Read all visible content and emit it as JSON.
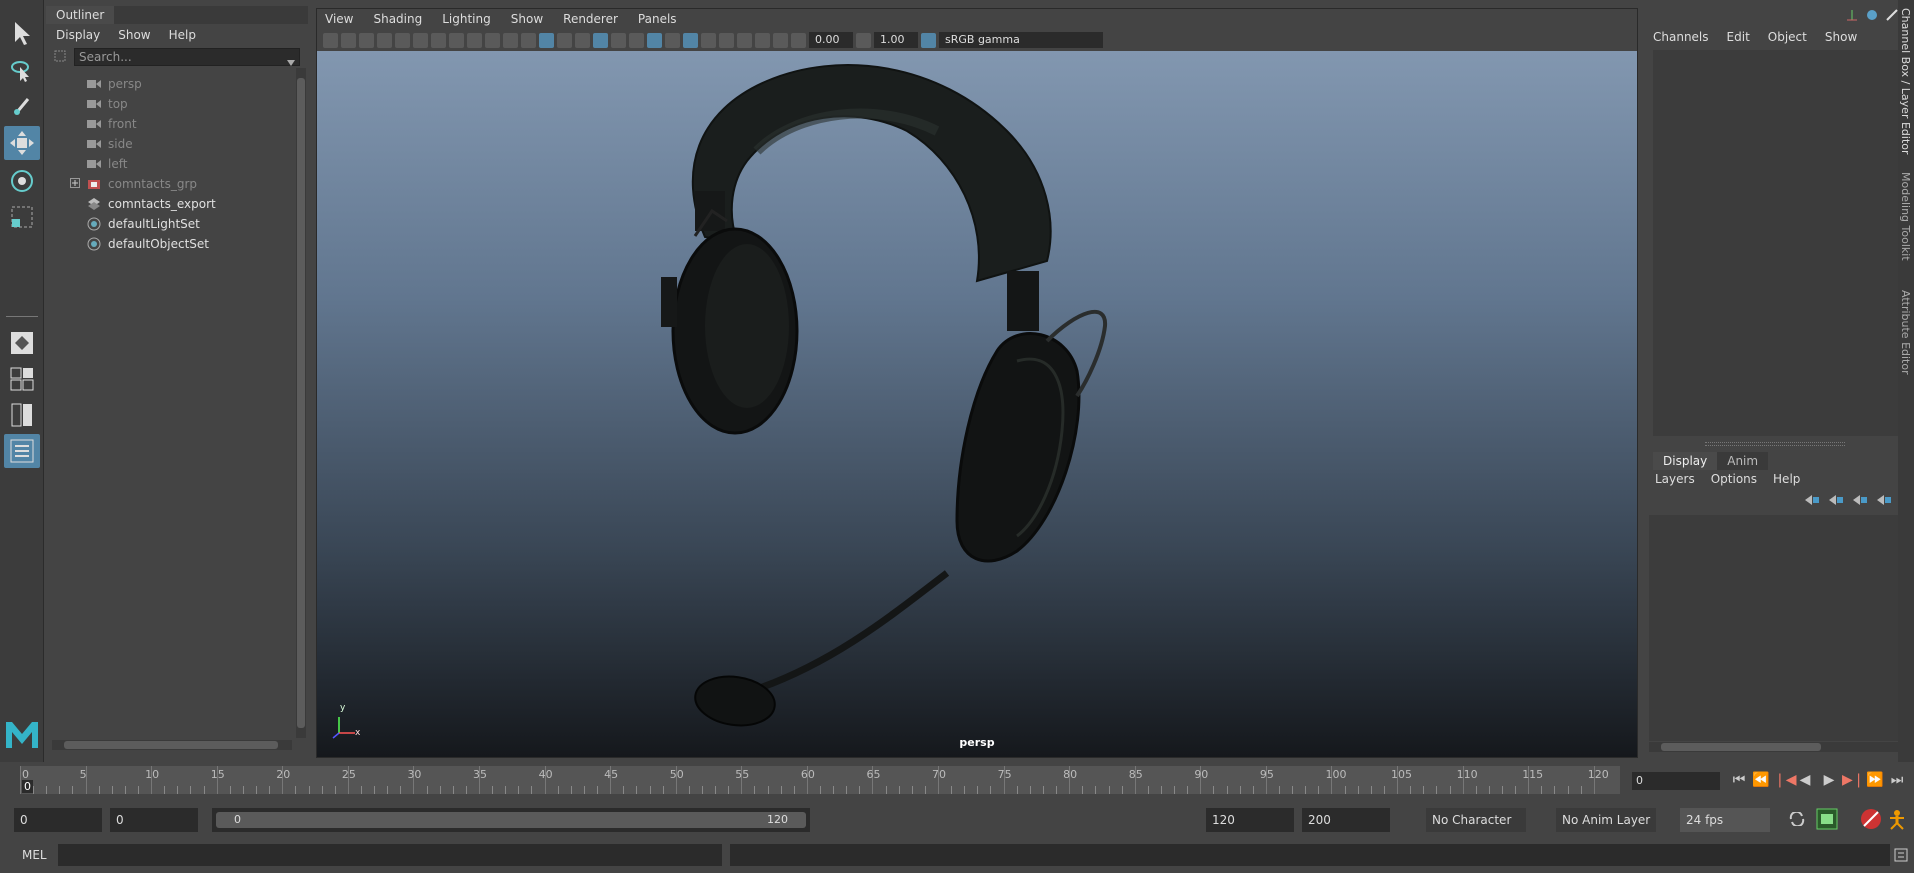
{
  "outliner": {
    "tab_label": "Outliner",
    "menu": [
      "Display",
      "Show",
      "Help"
    ],
    "search_placeholder": "Search...",
    "items": [
      {
        "label": "persp",
        "icon": "camera-icon",
        "dim": true
      },
      {
        "label": "top",
        "icon": "camera-icon",
        "dim": true
      },
      {
        "label": "front",
        "icon": "camera-icon",
        "dim": true
      },
      {
        "label": "side",
        "icon": "camera-icon",
        "dim": true
      },
      {
        "label": "left",
        "icon": "camera-icon",
        "dim": true
      },
      {
        "label": "comntacts_grp",
        "icon": "group-icon",
        "dim": true,
        "expandable": true
      },
      {
        "label": "comntacts_export",
        "icon": "set-icon",
        "dim": false
      },
      {
        "label": "defaultLightSet",
        "icon": "light-set-icon",
        "dim": false
      },
      {
        "label": "defaultObjectSet",
        "icon": "object-set-icon",
        "dim": false
      }
    ]
  },
  "viewport": {
    "menu": [
      "View",
      "Shading",
      "Lighting",
      "Show",
      "Renderer",
      "Panels"
    ],
    "exposure": "0.00",
    "gamma": "1.00",
    "color_space": "sRGB gamma",
    "camera_label": "persp",
    "axis_y": "y",
    "axis_x": "x"
  },
  "channelbox": {
    "menu": [
      "Channels",
      "Edit",
      "Object",
      "Show"
    ],
    "side_tabs": [
      "Channel Box / Layer Editor",
      "Modeling Toolkit",
      "Attribute Editor"
    ],
    "layer_tabs": [
      "Display",
      "Anim"
    ],
    "layer_menu": [
      "Layers",
      "Options",
      "Help"
    ]
  },
  "timeslider": {
    "labels": [
      "5",
      "10",
      "15",
      "20",
      "25",
      "30",
      "35",
      "40",
      "45",
      "50",
      "55",
      "60",
      "65",
      "70",
      "75",
      "80",
      "85",
      "90",
      "95",
      "100",
      "105",
      "110",
      "115",
      "120"
    ],
    "start_label": "0",
    "start_frame": "0",
    "current_frame": "0"
  },
  "range": {
    "start": "0",
    "anim_start": "0",
    "range_start_label": "0",
    "range_end_label": "120",
    "end": "120",
    "anim_end": "200",
    "character_set": "No Character Set",
    "anim_layer": "No Anim Layer",
    "fps": "24 fps"
  },
  "cmd": {
    "label": "MEL"
  },
  "colors": {
    "accent": "#5285a6",
    "panel": "#444444",
    "field": "#2b2b2b"
  }
}
